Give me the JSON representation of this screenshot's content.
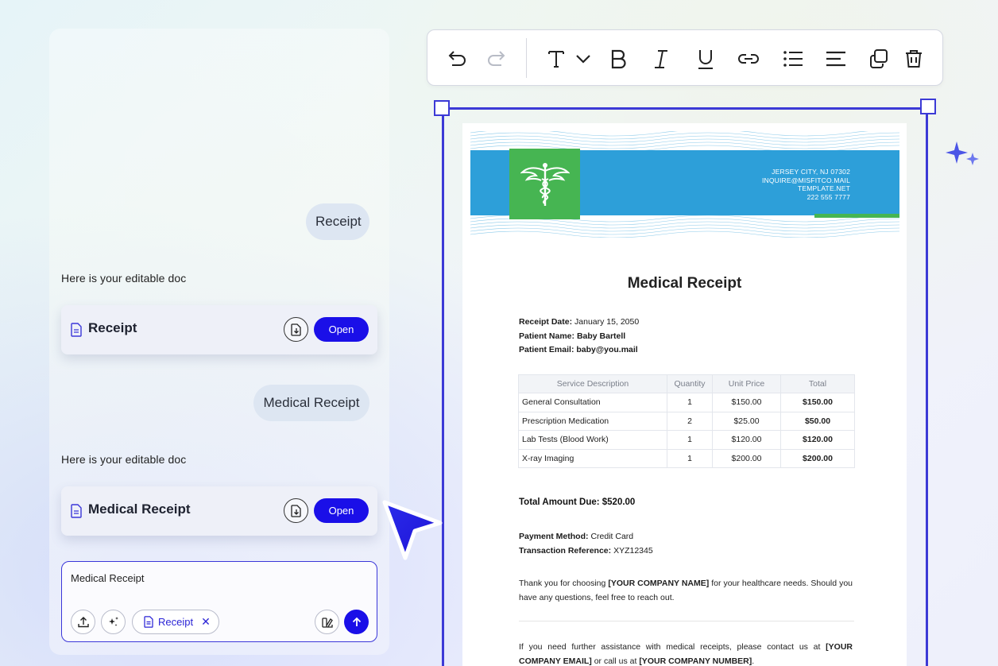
{
  "chat": {
    "messages": [
      {
        "role": "user",
        "text": "Receipt"
      },
      {
        "role": "assistant",
        "text": "Here is your editable doc"
      },
      {
        "role": "user",
        "text": "Medical Receipt"
      },
      {
        "role": "assistant",
        "text": "Here is your editable doc"
      }
    ],
    "doc_cards": [
      {
        "title": "Receipt",
        "open_label": "Open"
      },
      {
        "title": "Medical Receipt",
        "open_label": "Open"
      }
    ],
    "input": {
      "value": "Medical Receipt",
      "chip_label": "Receipt",
      "chip_remove": "✕"
    }
  },
  "toolbar": {
    "icons": [
      "undo-icon",
      "redo-icon",
      "text-style-icon",
      "bold-icon",
      "italic-icon",
      "underline-icon",
      "link-icon",
      "bullet-list-icon",
      "align-icon",
      "duplicate-icon",
      "delete-icon"
    ]
  },
  "document": {
    "header": {
      "address": "JERSEY CITY, NJ 07302",
      "email": "INQUIRE@MISFITCO.MAIL",
      "website": "TEMPLATE.NET",
      "phone": "222 555 7777"
    },
    "title": "Medical Receipt",
    "receipt_date_label": "Receipt Date:",
    "receipt_date": "January 15, 2050",
    "patient_name_label": "Patient Name:",
    "patient_name": "Baby Bartell",
    "patient_email_label": "Patient Email:",
    "patient_email": "baby@you.mail",
    "table": {
      "headers": [
        "Service Description",
        "Quantity",
        "Unit Price",
        "Total"
      ],
      "rows": [
        [
          "General Consultation",
          "1",
          "$150.00",
          "$150.00"
        ],
        [
          "Prescription Medication",
          "2",
          "$25.00",
          "$50.00"
        ],
        [
          "Lab Tests (Blood Work)",
          "1",
          "$120.00",
          "$120.00"
        ],
        [
          "X-ray Imaging",
          "1",
          "$200.00",
          "$200.00"
        ]
      ]
    },
    "total_due": "Total Amount Due: $520.00",
    "payment_method_label": "Payment Method:",
    "payment_method": "Credit Card",
    "transaction_ref_label": "Transaction Reference:",
    "transaction_ref": "XYZ12345",
    "thanks": {
      "before": "Thank you for choosing ",
      "company": "[YOUR COMPANY NAME]",
      "after": " for your healthcare needs. Should you have any questions, feel free to reach out."
    },
    "assist": {
      "before": "If you need further assistance with medical receipts, please contact us at ",
      "email": "[YOUR COMPANY EMAIL]",
      "middle": " or call us at ",
      "number": "[YOUR COMPANY NUMBER]",
      "after": "."
    }
  },
  "colors": {
    "accent": "#1a0fe8",
    "selection": "#3c3ad6",
    "header_blue": "#2d9fd9",
    "header_green": "#46b552"
  }
}
